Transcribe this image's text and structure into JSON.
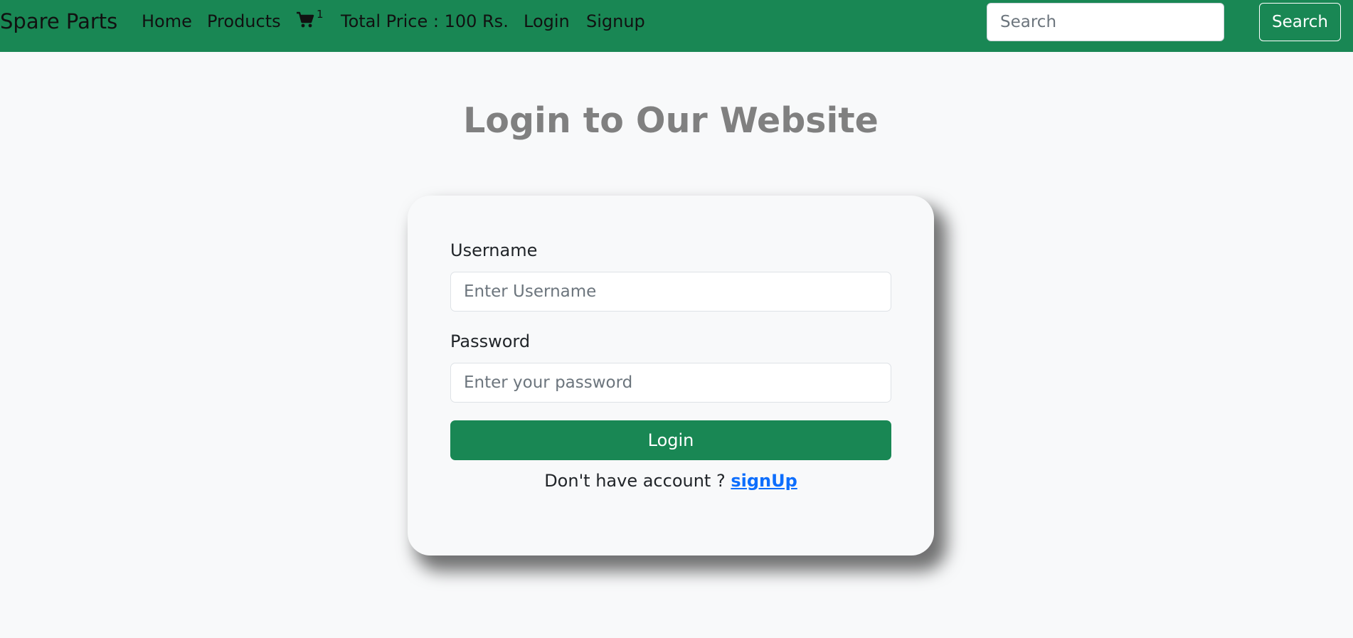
{
  "navbar": {
    "brand": "Spare Parts",
    "links": {
      "home": "Home",
      "products": "Products",
      "total_price": "Total Price : 100 Rs.",
      "login": "Login",
      "signup": "Signup"
    },
    "cart": {
      "icon": "cart-icon",
      "count": "1"
    },
    "search": {
      "placeholder": "Search",
      "button_label": "Search"
    }
  },
  "page": {
    "title": "Login to Our Website"
  },
  "login_form": {
    "username_label": "Username",
    "username_placeholder": "Enter Username",
    "password_label": "Password",
    "password_placeholder": "Enter your password",
    "submit_label": "Login",
    "signup_prompt": "Don't have account ?",
    "signup_link": "signUp"
  },
  "colors": {
    "navbar_bg": "#198754",
    "page_bg": "#f8f9fa",
    "button_green": "#198754",
    "link_blue": "#0d6efd",
    "title_gray": "#808080"
  }
}
